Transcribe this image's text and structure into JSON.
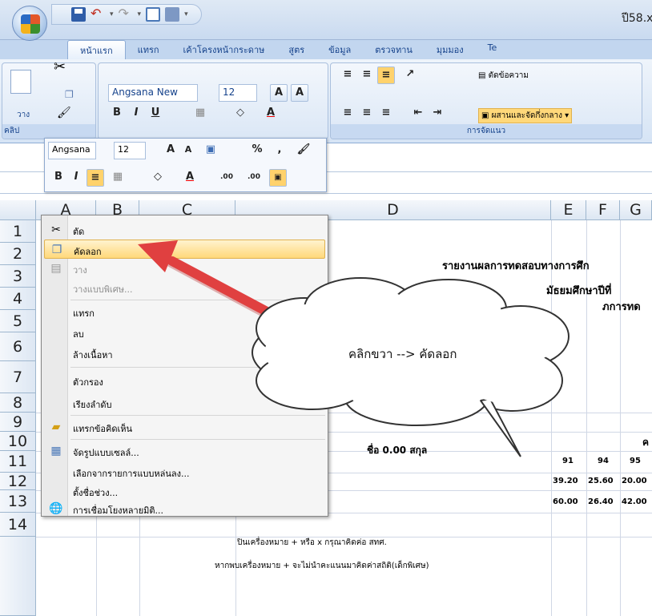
{
  "window": {
    "title": "ปี58.x"
  },
  "tabs": [
    "หน้าแรก",
    "แทรก",
    "เค้าโครงหน้ากระดาษ",
    "สูตร",
    "ข้อมูล",
    "ตรวจทาน",
    "มุมมอง",
    "Te"
  ],
  "ribbon": {
    "font_name": "Angsana New",
    "font_size": "12",
    "paste_label": "วาง",
    "clipboard_label": "คลิป",
    "wrap_text": "ตัดข้อความ",
    "merge_center": "ผสานและจัดกึ่งกลาง",
    "alignment_label": "การจัดแนว",
    "bold": "B",
    "italic": "I",
    "underline": "U",
    "grow": "A",
    "shrink": "A",
    "font_color": "A"
  },
  "mini_toolbar": {
    "font_name": "Angsana",
    "font_size": "12",
    "percent": "%",
    "comma": ",",
    "bold": "B",
    "italic": "I",
    "color_a": "A",
    "grow": "A",
    "shrink": "A",
    "inc_dec": ".00",
    "dec_dec": ".00"
  },
  "columns": [
    "A",
    "B",
    "C",
    "D",
    "E",
    "F",
    "G"
  ],
  "rows": [
    "1",
    "2",
    "3",
    "4",
    "5",
    "6",
    "7",
    "8",
    "9",
    "10",
    "11",
    "12",
    "13",
    "14"
  ],
  "cells": {
    "d2": "รายงานผลการทดสอบทางการศึก",
    "d3": "มัธยมศึกษาปีที่",
    "d4": "ภการทด",
    "d8": "ชื่อ 0.00 สกุล",
    "g8": "ค",
    "e9": "91",
    "f9": "94",
    "g9": "95",
    "e10": "39.20",
    "f10": "25.60",
    "g10": "20.00",
    "e11": "60.00",
    "f11": "26.40",
    "g11": "42.00",
    "d13": "ปินเครื่องหมาย + หรือ x กรุณาคิดค่อ สทศ.",
    "d14": "หากพบเครื่องหมาย + จะไม่นำคะแนนมาคิดค่าสถิติ(เด็กพิเศษ)"
  },
  "context_menu": [
    {
      "label": "ตัด",
      "icon": "scissors-icon"
    },
    {
      "label": "คัดลอก",
      "icon": "copy-icon"
    },
    {
      "label": "วาง",
      "icon": "paste-icon"
    },
    {
      "label": "วางแบบพิเศษ..."
    },
    {
      "label": "แทรก"
    },
    {
      "label": "ลบ"
    },
    {
      "label": "ล้างเนื้อหา"
    },
    {
      "label": "ตัวกรอง"
    },
    {
      "label": "เรียงลำดับ"
    },
    {
      "label": "แทรกข้อคิดเห็น",
      "icon": "comment-icon"
    },
    {
      "label": "จัดรูปแบบเซลล์...",
      "icon": "format-cells-icon"
    },
    {
      "label": "เลือกจากรายการแบบหล่นลง..."
    },
    {
      "label": "ตั้งชื่อช่วง..."
    },
    {
      "label": "การเชื่อมโยงหลายมิติ...",
      "icon": "hyperlink-icon"
    }
  ],
  "callout": {
    "text": "คลิกขวา --> คัดลอก"
  },
  "colors": {
    "highlight": "#ffd87a",
    "arrow": "#e04040",
    "ribbon": "#c2d6ef"
  }
}
